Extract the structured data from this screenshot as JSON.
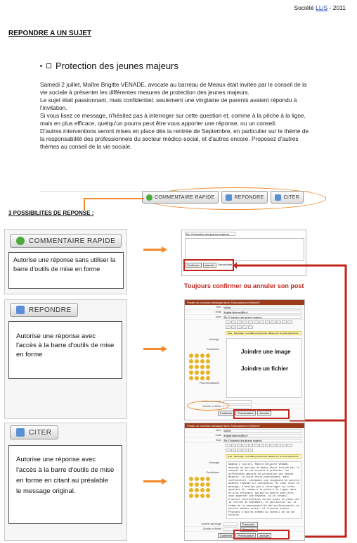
{
  "header": {
    "company_prefix": "Société",
    "company_link": "LLiS",
    "year_sep": " - ",
    "year": "2011"
  },
  "page_title": "REPONDRE A UN SUJET",
  "post": {
    "title": "Protection des jeunes majeurs",
    "paragraphs": [
      "Samedi 2 juillet, Maître Brigitte VENADE, avocate au barreau de Meaux était invitée par le conseil de la vie sociale à présenter les différentes mesures de protection des jeunes majeurs.",
      "Le sujet était passionnant, mais confidentiel. seulement une vingtaine de parents avaient répondu à l'invitation.",
      "Si vous lisez ce message, n'hésitez pas à interroger sur cette question et, comme à la pêche à la ligne, mais en plus efficace, quelqu'un pourra peut être vous apporter une réponse, ou un conseil.",
      "D'autres interventions seront mises en place dès la rentrée de Septembre, en particulier sur le thème de la responsabilité des professionnels du secteur médico-social, et d'autres encore. Proposez d'autres thèmes au conseil de la vie sociale."
    ]
  },
  "buttons": {
    "quick": "COMMENTAIRE RAPIDE",
    "reply": "REPONDRE",
    "quote": "CITER"
  },
  "section_title": "3 POSSIBILITES DE REPONSE :",
  "options": [
    {
      "button": "COMMENTAIRE RAPIDE",
      "desc": "Autorise une réponse sans utiliser la barre d'outils de mise en forme"
    },
    {
      "button": "REPONDRE",
      "desc": "Autorise une réponse avec l'accès à la barre d'outils de mise en forme"
    },
    {
      "button": "CITER",
      "desc": "Autorise une réponse avec l'accès à la barre d'outils de mise en forme en citant au préalable le message original."
    }
  ],
  "quick_panel": {
    "subject": "Re: Protection des jeunes majeurs",
    "confirm": "Confirmer",
    "cancel": "annuler",
    "preview": "Secondaire"
  },
  "note_confirm": "Toujours confirmer ou annuler son post",
  "note_image": "Joindre une image",
  "note_file": "Joindre un fichier",
  "form": {
    "head": "Poster un nouveau message dans \"Discussions et fichiers\"",
    "labels": [
      "Nom",
      "email",
      "Sujet"
    ],
    "values": [
      "admin",
      "brigitte.latenne@llis.fr",
      "Re: Protection des jeunes majeurs"
    ],
    "message_label": "Message",
    "smileys_label": "Emoticônes",
    "more_smileys": "Plus d'émoticônes",
    "attach_image": "Joindre une image",
    "attach_file": "Joindre un fichier",
    "browse": "Parcourir...",
    "confirm": "Confirmer",
    "preview": "Prévisualiser",
    "cancel": "Annuler",
    "note": "Note : Remarque : Les tailles peuvent être utilisées sur un texte sélectionné"
  }
}
